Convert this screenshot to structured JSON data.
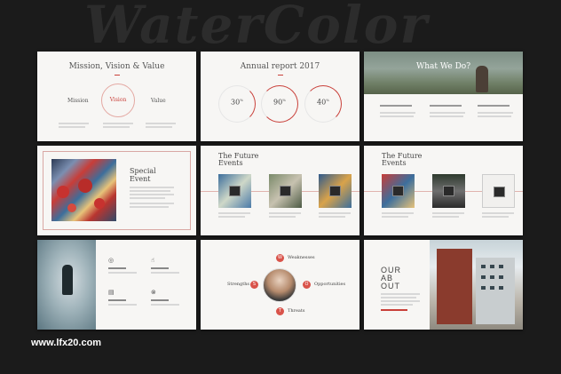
{
  "background_title": "WaterColor",
  "colors": {
    "accent": "#c9403a",
    "page_bg": "#1b1b1b",
    "slide_bg": "#f7f6f4"
  },
  "slides": {
    "mvv": {
      "title": "Mission, Vision & Value",
      "labels": [
        "Mission",
        "Vision",
        "Value"
      ]
    },
    "annual": {
      "title": "Annual report 2017",
      "percents": [
        "30",
        "90",
        "40"
      ],
      "percent_sign": "%"
    },
    "what_we_do": {
      "title": "What We Do?"
    },
    "special_event": {
      "title_line1": "Special",
      "title_line2": "Event"
    },
    "future_events_1": {
      "title_line1": "The Future",
      "title_line2": "Events"
    },
    "future_events_2": {
      "title_line1": "The Future",
      "title_line2": "Events"
    },
    "swot": {
      "labels": [
        "Weaknesses",
        "Strengths",
        "Opportunities",
        "Threats"
      ]
    },
    "about": {
      "line1": "OUR",
      "line2": "AB",
      "line3": "OUT"
    }
  },
  "watermark": "www.lfx20.com"
}
